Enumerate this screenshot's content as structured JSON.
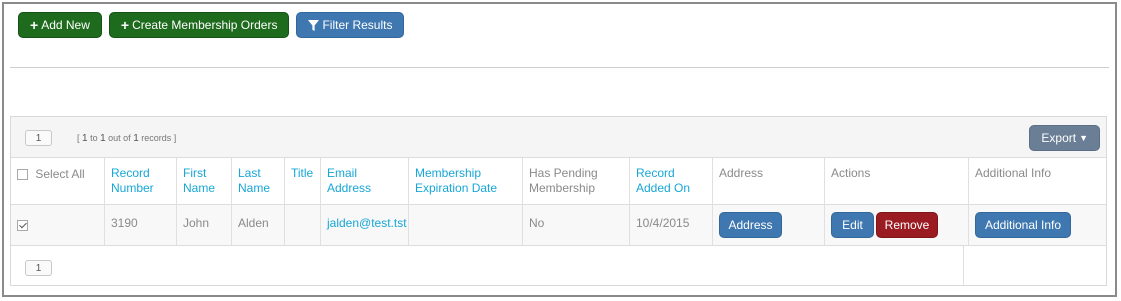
{
  "toolbar": {
    "add_new": "Add New",
    "create_orders": "Create Membership Orders",
    "filter": "Filter Results"
  },
  "grid": {
    "page": "1",
    "paging_prefix": "[ ",
    "paging_from": "1",
    "paging_to_word": " to ",
    "paging_to": "1",
    "paging_outof": " out of ",
    "paging_total": "1",
    "paging_suffix": " records ]",
    "export": "Export",
    "select_all": "Select All",
    "columns": {
      "record_number": "Record Number",
      "first_name": "First Name",
      "last_name": "Last Name",
      "title": "Title",
      "email": "Email Address",
      "membership_exp": "Membership Expiration Date",
      "has_pending": "Has Pending Membership",
      "record_added": "Record Added On",
      "address": "Address",
      "actions": "Actions",
      "additional_info": "Additional Info"
    },
    "rows": [
      {
        "record_number": "3190",
        "first_name": "John",
        "last_name": "Alden",
        "title": "",
        "email": "jalden@test.tst",
        "membership_exp": "",
        "has_pending": "No",
        "record_added": "10/4/2015",
        "address_btn": "Address",
        "edit_btn": "Edit",
        "remove_btn": "Remove",
        "info_btn": "Additional Info"
      }
    ]
  },
  "colors": {
    "green": "#1e6b1e",
    "blue": "#3f78b0",
    "red": "#9b1b22",
    "link": "#17a6d6"
  }
}
